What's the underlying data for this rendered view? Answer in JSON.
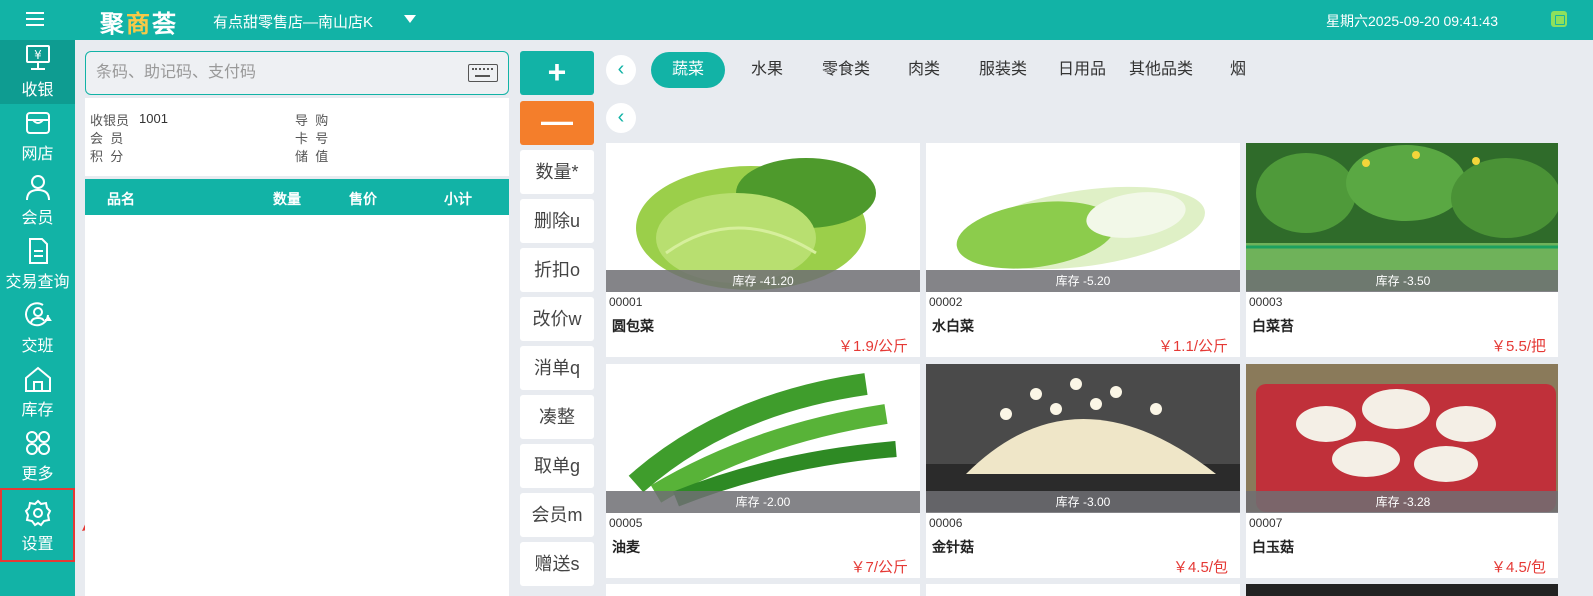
{
  "header": {
    "logo": "聚商荟",
    "store": "有点甜零售店—南山店K",
    "datetime": "星期六2025-09-20 09:41:43"
  },
  "sidebar": {
    "items": [
      {
        "label": "收银",
        "icon": "cashier-icon"
      },
      {
        "label": "网店",
        "icon": "store-icon"
      },
      {
        "label": "会员",
        "icon": "user-icon"
      },
      {
        "label": "交易查询",
        "icon": "document-icon"
      },
      {
        "label": "交班",
        "icon": "shift-icon"
      },
      {
        "label": "库存",
        "icon": "warehouse-icon"
      },
      {
        "label": "更多",
        "icon": "grid-icon"
      },
      {
        "label": "设置",
        "icon": "gear-icon"
      }
    ]
  },
  "search": {
    "placeholder": "条码、助记码、支付码"
  },
  "info": {
    "cashier_label": "收银员",
    "cashier_value": "1001",
    "guide_label": "导  购",
    "member_label": "会  员",
    "card_label": "卡  号",
    "points_label": "积  分",
    "balance_label": "储  值"
  },
  "table": {
    "headers": [
      "品名",
      "数量",
      "售价",
      "小计"
    ]
  },
  "actions": {
    "plus": "+",
    "minus": "—",
    "buttons": [
      "数量*",
      "删除u",
      "折扣o",
      "改价w",
      "消单q",
      "凑整",
      "取单g",
      "会员m",
      "赠送s"
    ]
  },
  "categories": [
    "蔬菜",
    "水果",
    "零食类",
    "肉类",
    "服装类",
    "日用品",
    "其他品类",
    "烟"
  ],
  "back_glyph": "‹",
  "products": [
    {
      "code": "00001",
      "name": "圆包菜",
      "price": "￥1.9/公斤",
      "stock": "库存 -41.20"
    },
    {
      "code": "00002",
      "name": "水白菜",
      "price": "￥1.1/公斤",
      "stock": "库存 -5.20"
    },
    {
      "code": "00003",
      "name": "白菜苔",
      "price": "￥5.5/把",
      "stock": "库存 -3.50"
    },
    {
      "code": "00005",
      "name": "油麦",
      "price": "￥7/公斤",
      "stock": "库存 -2.00"
    },
    {
      "code": "00006",
      "name": "金针菇",
      "price": "￥4.5/包",
      "stock": "库存 -3.00"
    },
    {
      "code": "00007",
      "name": "白玉菇",
      "price": "￥4.5/包",
      "stock": "库存 -3.28"
    }
  ]
}
